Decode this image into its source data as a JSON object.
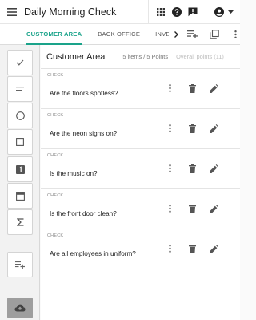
{
  "appbar": {
    "title": "Daily Morning Check",
    "icons": [
      "menu-icon",
      "apps-grid-icon",
      "help-icon",
      "feedback-icon",
      "account-icon",
      "dropdown-icon"
    ]
  },
  "tabs": {
    "items": [
      {
        "label": "Customer Area",
        "active": true
      },
      {
        "label": "Back Office",
        "active": false
      },
      {
        "label": "Inven",
        "active": false
      }
    ],
    "icons": [
      "chevron-right-icon",
      "add-section-icon",
      "copy-icon",
      "more-vert-icon"
    ]
  },
  "sidebar": {
    "tools": [
      "check-icon",
      "text-icon",
      "radio-icon",
      "checkbox-icon",
      "number-icon",
      "date-icon",
      "sum-icon",
      "add-list-icon"
    ],
    "upload_icon": "cloud-upload-icon"
  },
  "section": {
    "title": "Customer Area",
    "count": "5 items / 5 Points",
    "overall": "Overall points (11)"
  },
  "items": [
    {
      "type_label": "CHECK",
      "question": "Are the floors spotless?"
    },
    {
      "type_label": "CHECK",
      "question": "Are the neon signs on?"
    },
    {
      "type_label": "CHECK",
      "question": "Is the music on?"
    },
    {
      "type_label": "CHECK",
      "question": "Is the front door clean?"
    },
    {
      "type_label": "CHECK",
      "question": "Are all employees in uniform?"
    }
  ],
  "colors": {
    "accent": "#1aa38a",
    "text": "#212121",
    "icon": "#616161",
    "upload": "#9e9e9e"
  }
}
